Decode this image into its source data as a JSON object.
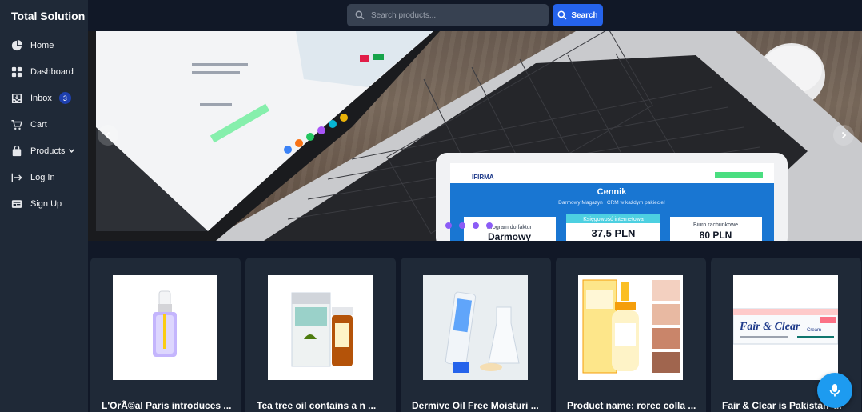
{
  "brand": "Total Solution",
  "sidebar": {
    "items": [
      {
        "label": "Home",
        "icon": "pie-chart-icon"
      },
      {
        "label": "Dashboard",
        "icon": "grid-icon"
      },
      {
        "label": "Inbox",
        "icon": "inbox-icon",
        "badge": "3"
      },
      {
        "label": "Cart",
        "icon": "cart-icon"
      },
      {
        "label": "Products",
        "icon": "bag-icon",
        "has_dropdown": true
      },
      {
        "label": "Log In",
        "icon": "login-icon"
      },
      {
        "label": "Sign Up",
        "icon": "signup-icon"
      }
    ]
  },
  "search": {
    "placeholder": "Search products...",
    "button_label": "Search"
  },
  "carousel": {
    "slide_count": 4,
    "slide": {
      "brand": "IFIRMA",
      "heading": "Cennik",
      "subheading": "Darmowy Magazyn i CRM w każdym pakiecie!",
      "plans": [
        {
          "name": "Program do faktur",
          "price": "Darmowy"
        },
        {
          "name": "Księgowość internetowa",
          "price": "37,5 PLN"
        },
        {
          "name": "Biuro rachunkowe",
          "price": "80 PLN"
        }
      ]
    }
  },
  "products": [
    {
      "name": "L'OrÃ©al Paris introduces ...",
      "image": "serum-dropper-bottle"
    },
    {
      "name": "Tea tree oil contains a n ...",
      "image": "tea-tree-oil-box-and-bottle"
    },
    {
      "name": "Dermive Oil Free Moisturi ...",
      "image": "moisturizer-tube-lab"
    },
    {
      "name": "Product name: rorec colla ...",
      "image": "white-rice-serum-box"
    },
    {
      "name": "Fair & Clear is Pakistan' ...",
      "image": "fair-and-clear-cream-tube"
    }
  ],
  "fair_clear_label": "Fair & Clear",
  "fair_clear_sub": "Cream",
  "colors": {
    "sidebar_bg": "#1f2937",
    "page_bg": "#111827",
    "accent": "#2563eb",
    "badge": "#1e40af",
    "dot": "#8b5cf6",
    "mic": "#1d9bf0"
  }
}
